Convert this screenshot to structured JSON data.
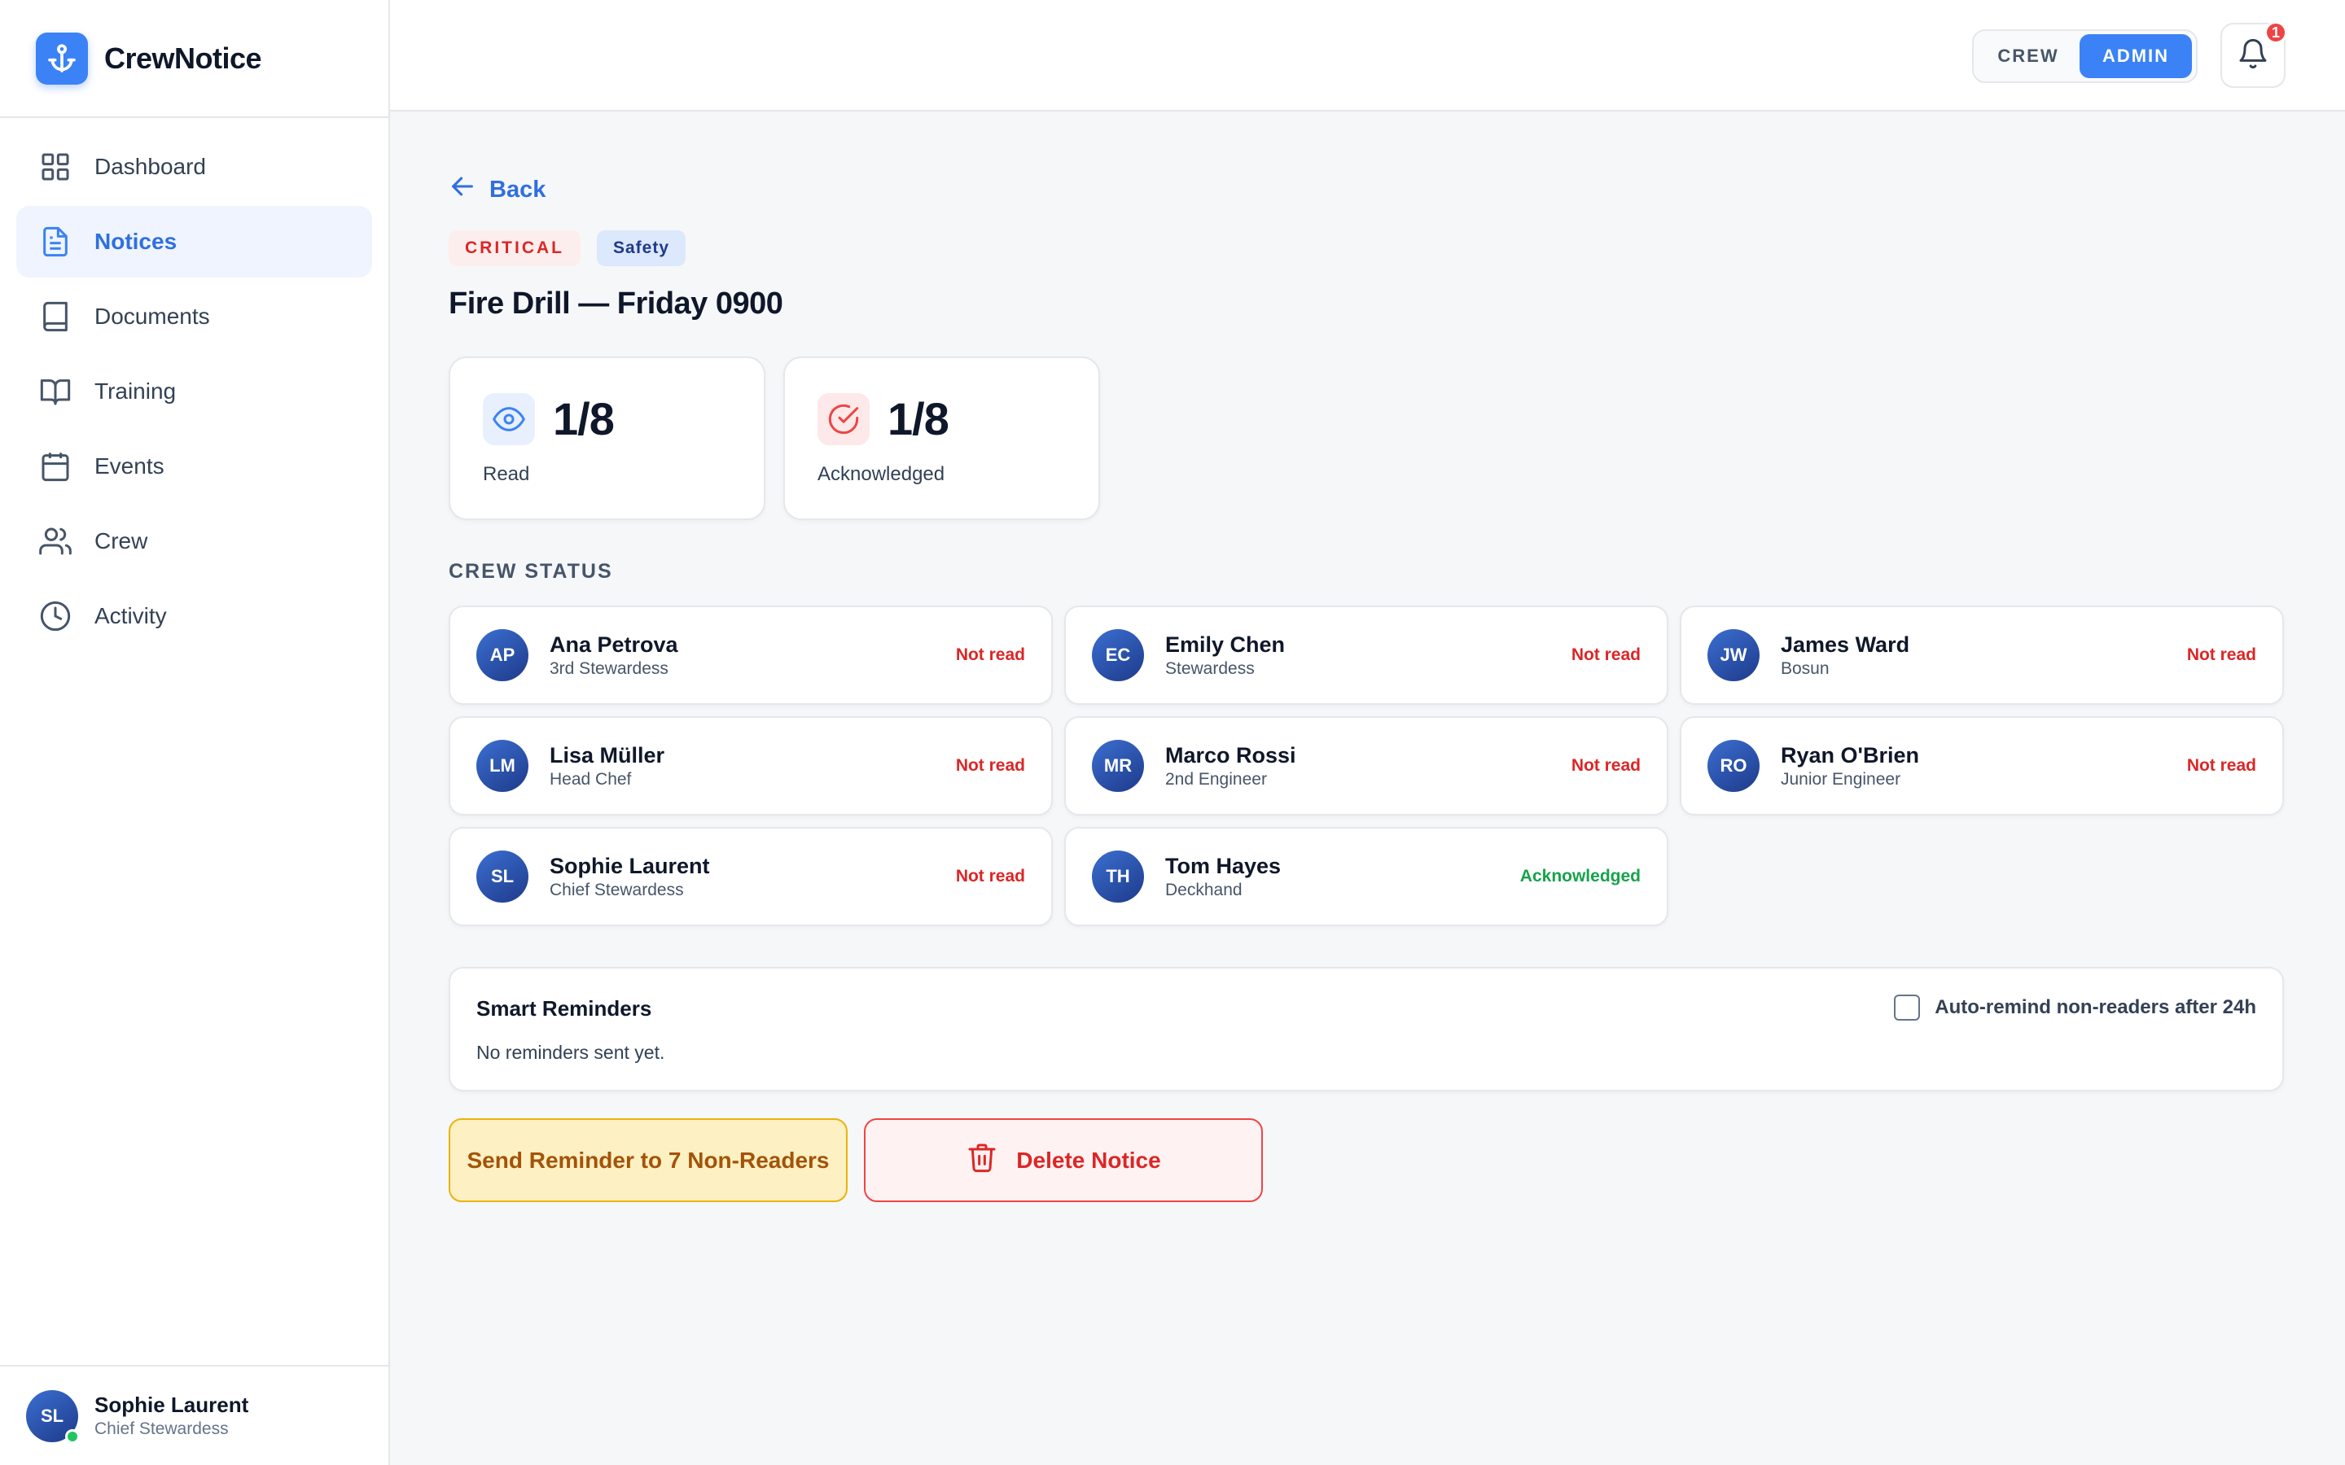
{
  "app": {
    "name": "CrewNotice"
  },
  "sidebar": {
    "items": [
      {
        "label": "Dashboard",
        "icon": "grid-icon"
      },
      {
        "label": "Notices",
        "icon": "file-text-icon",
        "active": true
      },
      {
        "label": "Documents",
        "icon": "book-icon"
      },
      {
        "label": "Training",
        "icon": "open-book-icon"
      },
      {
        "label": "Events",
        "icon": "calendar-icon"
      },
      {
        "label": "Crew",
        "icon": "users-icon"
      },
      {
        "label": "Activity",
        "icon": "clock-icon"
      }
    ],
    "user": {
      "initials": "SL",
      "name": "Sophie Laurent",
      "role": "Chief Stewardess"
    }
  },
  "topbar": {
    "role_toggle": {
      "crew": "CREW",
      "admin": "ADMIN",
      "selected": "ADMIN"
    },
    "notifications": {
      "count": "1"
    }
  },
  "notice": {
    "back_label": "Back",
    "priority": "CRITICAL",
    "category": "Safety",
    "title": "Fire Drill — Friday 0900",
    "stats": {
      "read": {
        "value": "1/8",
        "label": "Read"
      },
      "acknowledged": {
        "value": "1/8",
        "label": "Acknowledged"
      }
    }
  },
  "crew_status": {
    "heading": "CREW STATUS",
    "members": [
      {
        "initials": "AP",
        "name": "Ana Petrova",
        "role": "3rd Stewardess",
        "status": "Not read"
      },
      {
        "initials": "EC",
        "name": "Emily Chen",
        "role": "Stewardess",
        "status": "Not read"
      },
      {
        "initials": "JW",
        "name": "James Ward",
        "role": "Bosun",
        "status": "Not read"
      },
      {
        "initials": "LM",
        "name": "Lisa Müller",
        "role": "Head Chef",
        "status": "Not read"
      },
      {
        "initials": "MR",
        "name": "Marco Rossi",
        "role": "2nd Engineer",
        "status": "Not read"
      },
      {
        "initials": "RO",
        "name": "Ryan O'Brien",
        "role": "Junior Engineer",
        "status": "Not read"
      },
      {
        "initials": "SL",
        "name": "Sophie Laurent",
        "role": "Chief Stewardess",
        "status": "Not read"
      },
      {
        "initials": "TH",
        "name": "Tom Hayes",
        "role": "Deckhand",
        "status": "Acknowledged"
      }
    ]
  },
  "reminders": {
    "title": "Smart Reminders",
    "empty_text": "No reminders sent yet.",
    "auto_remind_label": "Auto-remind non-readers after 24h",
    "auto_remind_checked": false
  },
  "actions": {
    "send_reminder": "Send Reminder to 7 Non-Readers",
    "delete": "Delete Notice"
  },
  "colors": {
    "accent": "#3b82f6",
    "critical": "#dc2626",
    "acknowledged": "#16a34a",
    "warning_bg": "#fdf0c2"
  }
}
